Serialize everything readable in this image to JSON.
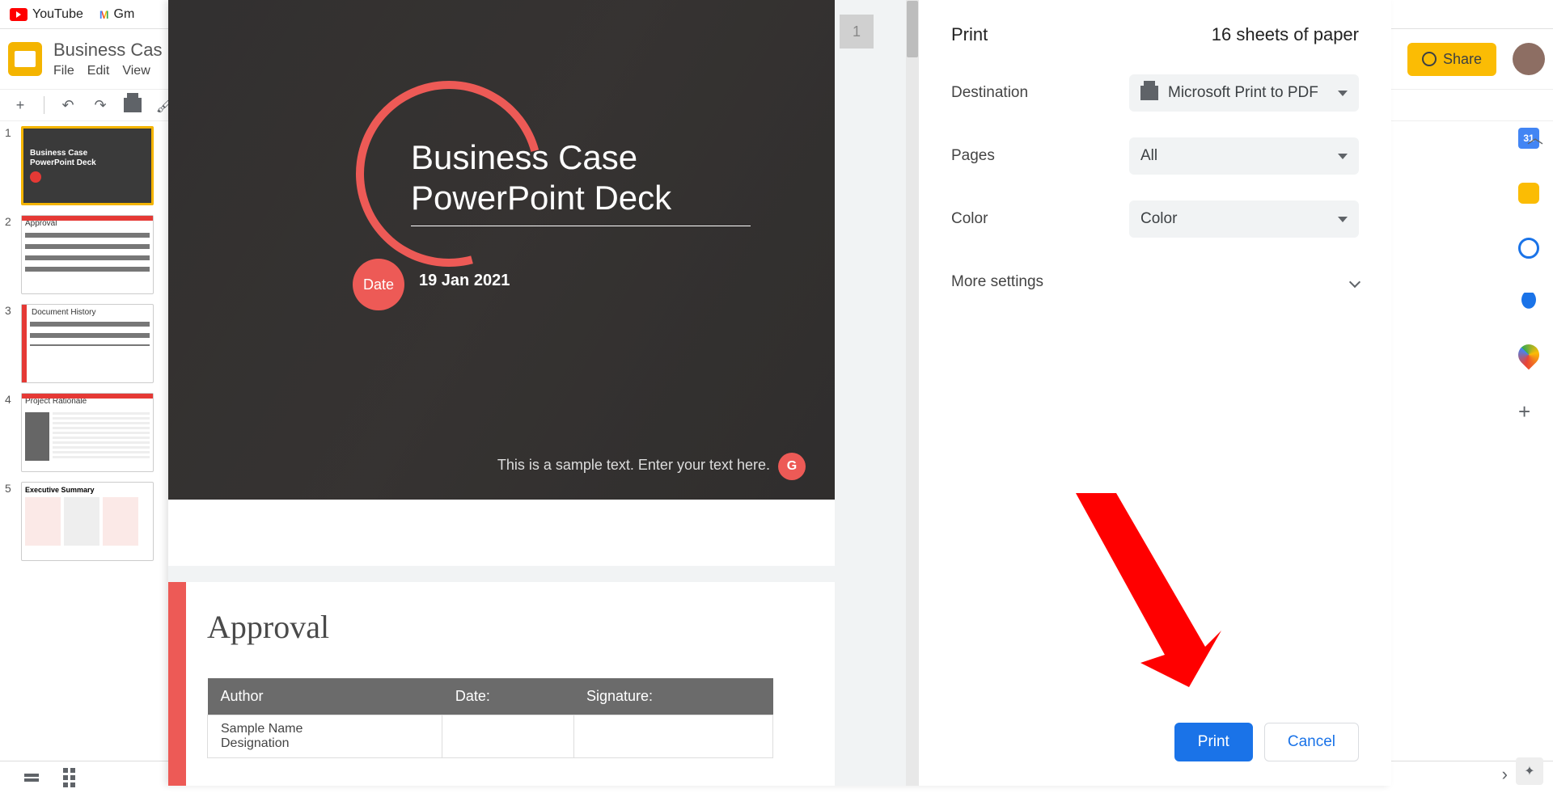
{
  "bookmarks": {
    "youtube": "YouTube",
    "gmail": "Gm"
  },
  "header": {
    "doc_title": "Business Cas",
    "menus": [
      "File",
      "Edit",
      "View"
    ],
    "share_label": "Share"
  },
  "print_dialog": {
    "title": "Print",
    "sheets_info": "16 sheets of paper",
    "destination_label": "Destination",
    "destination_value": "Microsoft Print to PDF",
    "pages_label": "Pages",
    "pages_value": "All",
    "color_label": "Color",
    "color_value": "Color",
    "more_settings": "More settings",
    "print_button": "Print",
    "cancel_button": "Cancel"
  },
  "preview": {
    "page1": {
      "number": "1",
      "title_line1": "Business Case",
      "title_line2": "PowerPoint Deck",
      "date_badge": "Date",
      "date_value": "19 Jan 2021",
      "sample_text": "This is a sample text. Enter your text here.",
      "g_badge": "G"
    },
    "page2": {
      "heading": "Approval",
      "cols": {
        "author": "Author",
        "date": "Date:",
        "signature": "Signature:"
      },
      "row1": {
        "name": "Sample Name",
        "designation": "Designation"
      }
    }
  },
  "thumbnails": [
    {
      "num": "1",
      "type": "title",
      "title1": "Business Case",
      "title2": "PowerPoint Deck"
    },
    {
      "num": "2",
      "type": "table",
      "title": "Approval"
    },
    {
      "num": "3",
      "type": "table",
      "title": "Document History"
    },
    {
      "num": "4",
      "type": "text",
      "title": "Project Rationale"
    },
    {
      "num": "5",
      "type": "exec",
      "title": "Executive Summary"
    }
  ],
  "sidebar_cal": "31"
}
